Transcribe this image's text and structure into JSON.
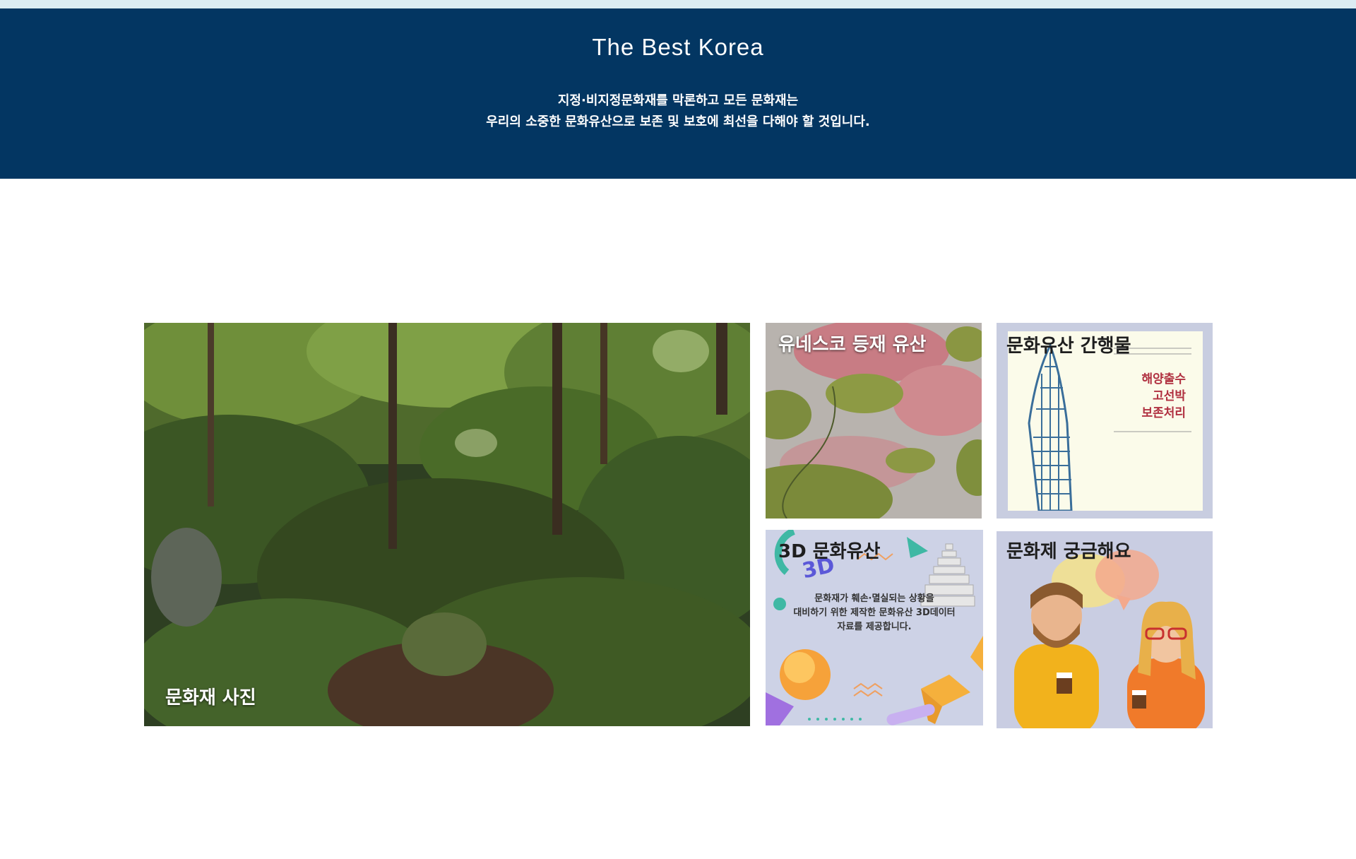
{
  "hero": {
    "title": "The Best Korea",
    "line1": "지정·비지정문화재를 막론하고 모든 문화재는",
    "line2": "우리의 소중한 문화유산으로 보존 및 보호에 최선을 다해야 할 것입니다."
  },
  "tiles": {
    "photo": {
      "label": "문화재 사진"
    },
    "unesco": {
      "label": "유네스코 등재 유산"
    },
    "publications": {
      "label": "문화유산 간행물",
      "cover_title": [
        "해양출수",
        "고선박",
        "보존처리"
      ]
    },
    "three_d": {
      "label": "3D 문화유산",
      "description": [
        "문화재가 훼손·멸실되는 상황을",
        "대비하기 위한 제작한 문화유산 3D데이터",
        "자료를 제공합니다."
      ]
    },
    "faq": {
      "label": "문화제 궁금해요"
    }
  },
  "colors": {
    "hero_bg": "#033662",
    "top_strip": "#dcecf3"
  }
}
